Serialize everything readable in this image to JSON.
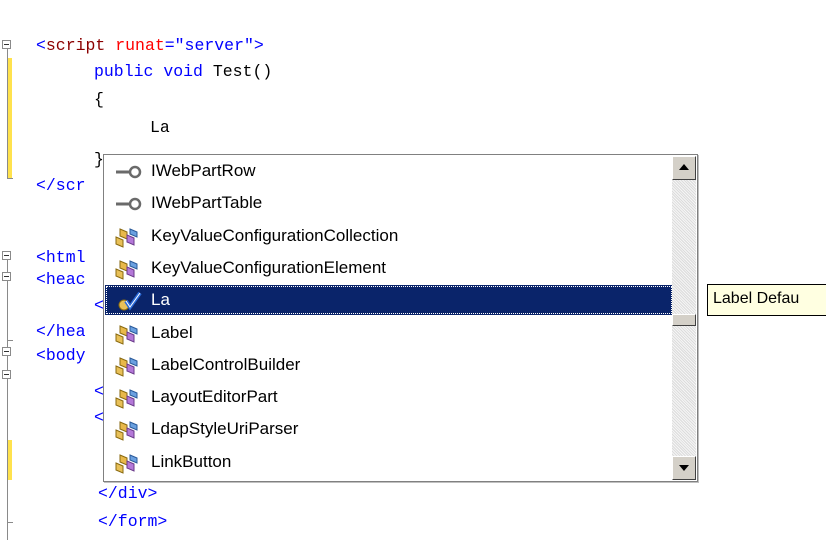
{
  "code": {
    "line1": {
      "open": "<",
      "tag": "script",
      "sp": " ",
      "attr": "runat",
      "eq": "=",
      "value": "\"server\"",
      "close": ">"
    },
    "line2": {
      "kw1": "public",
      "kw2": "void",
      "name": "Test()"
    },
    "line3": {
      "text": "{"
    },
    "line4": {
      "text": "La"
    },
    "line5": {
      "text": "}"
    },
    "line6": {
      "text": "</scr"
    },
    "line7": {
      "text": "<html"
    },
    "line8": {
      "text": "<heac"
    },
    "line9": {
      "text": "<"
    },
    "line10": {
      "text": "</hea"
    },
    "line11": {
      "text": "<body"
    },
    "line12": {
      "text": "<"
    },
    "line13": {
      "text": "<"
    },
    "line14": {
      "text": "</div>"
    },
    "line15": {
      "text": "</form>"
    }
  },
  "intellisense": {
    "items": [
      {
        "label": "IWebPartRow",
        "icon": "interface-icon"
      },
      {
        "label": "IWebPartTable",
        "icon": "interface-icon"
      },
      {
        "label": "KeyValueConfigurationCollection",
        "icon": "class-icon"
      },
      {
        "label": "KeyValueConfigurationElement",
        "icon": "class-icon"
      },
      {
        "label": "La",
        "icon": "snippet-check-icon",
        "selected": true
      },
      {
        "label": "Label",
        "icon": "class-icon"
      },
      {
        "label": "LabelControlBuilder",
        "icon": "class-icon"
      },
      {
        "label": "LayoutEditorPart",
        "icon": "class-icon"
      },
      {
        "label": "LdapStyleUriParser",
        "icon": "class-icon"
      },
      {
        "label": "LinkButton",
        "icon": "class-icon"
      }
    ],
    "scrollbar": {
      "position": 0.5
    }
  },
  "tooltip": {
    "text": "Label Defau"
  },
  "colors": {
    "tag": "#8b0000",
    "bracket": "#0000ff",
    "attr": "#ff0000",
    "keyword": "#0000ff",
    "selection": "#0a246a",
    "tooltip_bg": "#ffffe1"
  }
}
